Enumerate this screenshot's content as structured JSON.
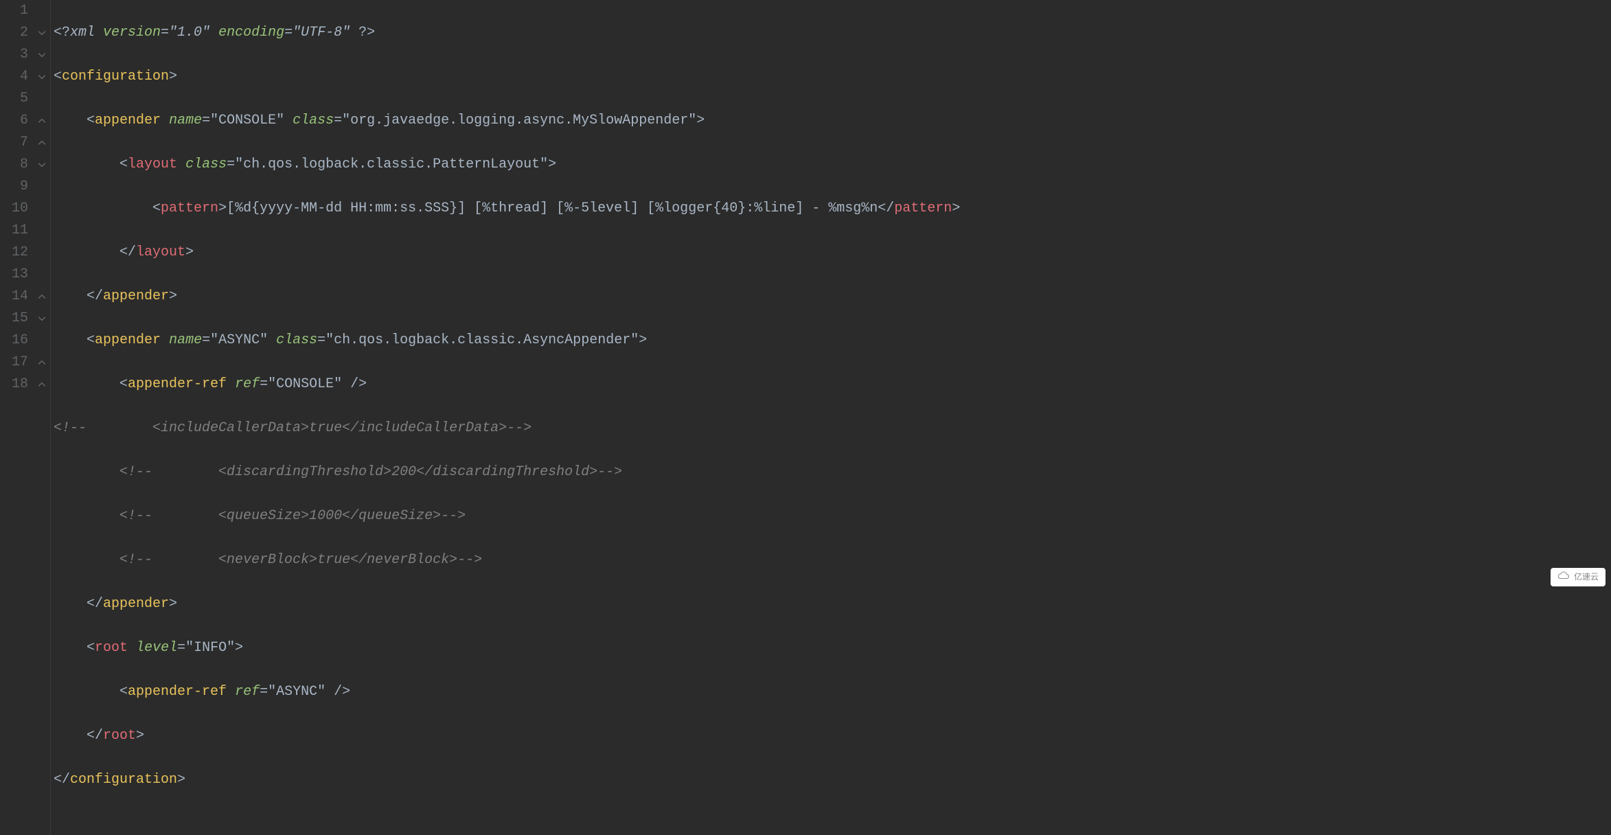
{
  "lineNumbers": [
    "1",
    "2",
    "3",
    "4",
    "5",
    "6",
    "7",
    "8",
    "9",
    "10",
    "11",
    "12",
    "13",
    "14",
    "15",
    "16",
    "17",
    "18"
  ],
  "xml": {
    "pi_open": "<?",
    "pi_nameq": "xml ",
    "pi_attr1": "version",
    "pi_val1": "=\"1.0\" ",
    "pi_attr2": "encoding",
    "pi_val2": "=\"UTF-8\" ",
    "pi_close": "?>"
  },
  "l2_open": "<",
  "l2_tag": "configuration",
  "l2_close": ">",
  "l3_open": "<",
  "l3_tag": "appender",
  "l3_sp": " ",
  "l3_attr1": "name",
  "l3_val1": "=\"CONSOLE\" ",
  "l3_attr2": "class",
  "l3_val2": "=\"org.javaedge.logging.async.MySlowAppender\"",
  "l3_close": ">",
  "l4_open": "<",
  "l4_tag": "layout",
  "l4_sp": " ",
  "l4_attr1": "class",
  "l4_val1": "=\"ch.qos.logback.classic.PatternLayout\"",
  "l4_close": ">",
  "l5_open": "<",
  "l5_tag": "pattern",
  "l5_gt": ">",
  "l5_txt": "[%d{yyyy-MM-dd HH:mm:ss.SSS}] [%thread] [%-5level] [%logger{40}:%line] - %msg%n",
  "l5_copen": "</",
  "l5_ctag": "pattern",
  "l5_cgt": ">",
  "l6_copen": "</",
  "l6_ctag": "layout",
  "l6_cgt": ">",
  "l7_copen": "</",
  "l7_ctag": "appender",
  "l7_cgt": ">",
  "l8_open": "<",
  "l8_tag": "appender",
  "l8_sp": " ",
  "l8_attr1": "name",
  "l8_val1": "=\"ASYNC\" ",
  "l8_attr2": "class",
  "l8_val2": "=\"ch.qos.logback.classic.AsyncAppender\"",
  "l8_close": ">",
  "l9_open": "<",
  "l9_tag": "appender-ref",
  "l9_sp": " ",
  "l9_attr1": "ref",
  "l9_val1": "=\"CONSOLE\" ",
  "l9_close": "/>",
  "l10_cmt": "<!--        <includeCallerData>true</includeCallerData>-->",
  "l11_cmt": "<!--        <discardingThreshold>200</discardingThreshold>-->",
  "l12_cmt": "<!--        <queueSize>1000</queueSize>-->",
  "l13_cmt": "<!--        <neverBlock>true</neverBlock>-->",
  "l14_copen": "</",
  "l14_ctag": "appender",
  "l14_cgt": ">",
  "l15_open": "<",
  "l15_tag": "root",
  "l15_sp": " ",
  "l15_attr1": "level",
  "l15_val1": "=\"INFO\"",
  "l15_close": ">",
  "l16_open": "<",
  "l16_tag": "appender-ref",
  "l16_sp": " ",
  "l16_attr1": "ref",
  "l16_val1": "=\"ASYNC\" ",
  "l16_close": "/>",
  "l17_copen": "</",
  "l17_ctag": "root",
  "l17_cgt": ">",
  "l18_copen": "</",
  "l18_ctag": "configuration",
  "l18_cgt": ">",
  "watermark": "亿速云"
}
